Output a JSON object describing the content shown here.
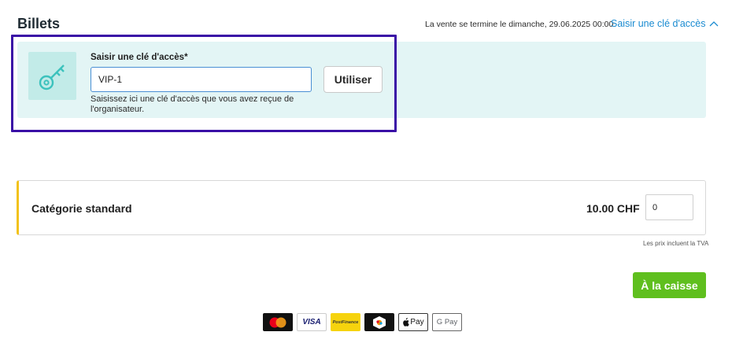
{
  "header": {
    "title": "Billets",
    "sale_end": "La vente se termine le dimanche, 29.06.2025 00:00",
    "access_toggle": "Saisir une clé d'accès"
  },
  "access_code": {
    "label": "Saisir une clé d'accès*",
    "value": "VIP-1",
    "apply_label": "Utiliser",
    "help": "Saisissez ici une clé d'accès que vous avez reçue de l'organisateur."
  },
  "tickets": [
    {
      "name": "Catégorie standard",
      "price": "10.00 CHF",
      "quantity": "0"
    }
  ],
  "vat_note": "Les prix incluent la TVA",
  "checkout_label": "À la caisse",
  "payment_methods": {
    "visa": "VISA",
    "postfinance": "PostFinance",
    "apple": "Pay",
    "google": "G Pay"
  },
  "colors": {
    "accent_link": "#1a8bd1",
    "panel_bg": "#e3f5f5",
    "focus_ring": "#3a10a6",
    "checkout": "#5fbf1e",
    "category_stripe": "#f2c21c"
  }
}
